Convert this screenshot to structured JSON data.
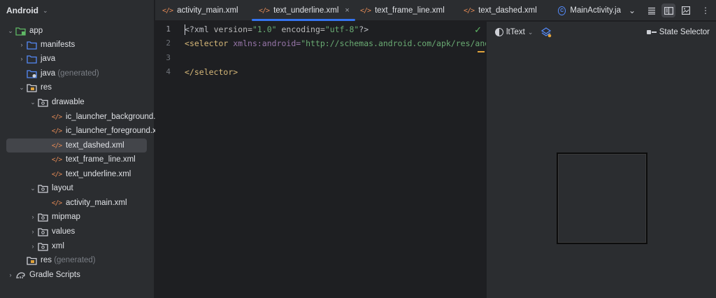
{
  "project": {
    "title": "Android",
    "tree": [
      {
        "label": "app",
        "icon": "module-folder-icon",
        "expanded": true
      },
      {
        "label": "manifests",
        "icon": "folder-icon",
        "expanded": false
      },
      {
        "label": "java",
        "icon": "folder-icon",
        "expanded": false
      },
      {
        "label": "java",
        "suffix": "(generated)",
        "icon": "generated-folder-icon"
      },
      {
        "label": "res",
        "icon": "res-folder-icon",
        "expanded": true
      },
      {
        "label": "drawable",
        "icon": "package-folder-icon",
        "expanded": true
      },
      {
        "label": "ic_launcher_background.xml",
        "icon": "xml-file-icon"
      },
      {
        "label": "ic_launcher_foreground.xml",
        "icon": "xml-file-icon"
      },
      {
        "label": "text_dashed.xml",
        "icon": "xml-file-icon",
        "selected": true
      },
      {
        "label": "text_frame_line.xml",
        "icon": "xml-file-icon"
      },
      {
        "label": "text_underline.xml",
        "icon": "xml-file-icon"
      },
      {
        "label": "layout",
        "icon": "package-folder-icon",
        "expanded": true
      },
      {
        "label": "activity_main.xml",
        "icon": "xml-file-icon"
      },
      {
        "label": "mipmap",
        "icon": "package-folder-icon",
        "expanded": false
      },
      {
        "label": "values",
        "icon": "package-folder-icon",
        "expanded": false
      },
      {
        "label": "xml",
        "icon": "package-folder-icon",
        "expanded": false
      },
      {
        "label": "res",
        "suffix": "(generated)",
        "icon": "res-folder-icon"
      },
      {
        "label": "Gradle Scripts",
        "icon": "gradle-icon",
        "expanded": false
      }
    ]
  },
  "tabs": [
    {
      "label": "activity_main.xml",
      "icon": "xml-file-icon"
    },
    {
      "label": "text_underline.xml",
      "icon": "xml-file-icon",
      "active": true
    },
    {
      "label": "text_frame_line.xml",
      "icon": "xml-file-icon"
    },
    {
      "label": "text_dashed.xml",
      "icon": "xml-file-icon"
    },
    {
      "label": "MainActivity.ja",
      "icon": "class-icon"
    }
  ],
  "editor": {
    "line_numbers": [
      "1",
      "2",
      "3",
      "4"
    ],
    "line1": {
      "pi_open": "<?",
      "tag": "xml",
      "attr1": " version=",
      "val1": "\"1.0\"",
      "attr2": " encoding=",
      "val2": "\"utf-8\"",
      "pi_close": "?>"
    },
    "line2": {
      "open": "<",
      "tag": "selector",
      "ns": " xmlns:android=",
      "val": "\"http://schemas.android.com/apk/res/and"
    },
    "line4": {
      "open": "</",
      "tag": "selector",
      "close": ">"
    }
  },
  "preview": {
    "theme_label": "ltText",
    "state_selector_label": "State Selector"
  },
  "colors": {
    "accent": "#3574f0",
    "xml_icon": "#e08855",
    "folder": "#548af7",
    "check": "#5fb865"
  }
}
